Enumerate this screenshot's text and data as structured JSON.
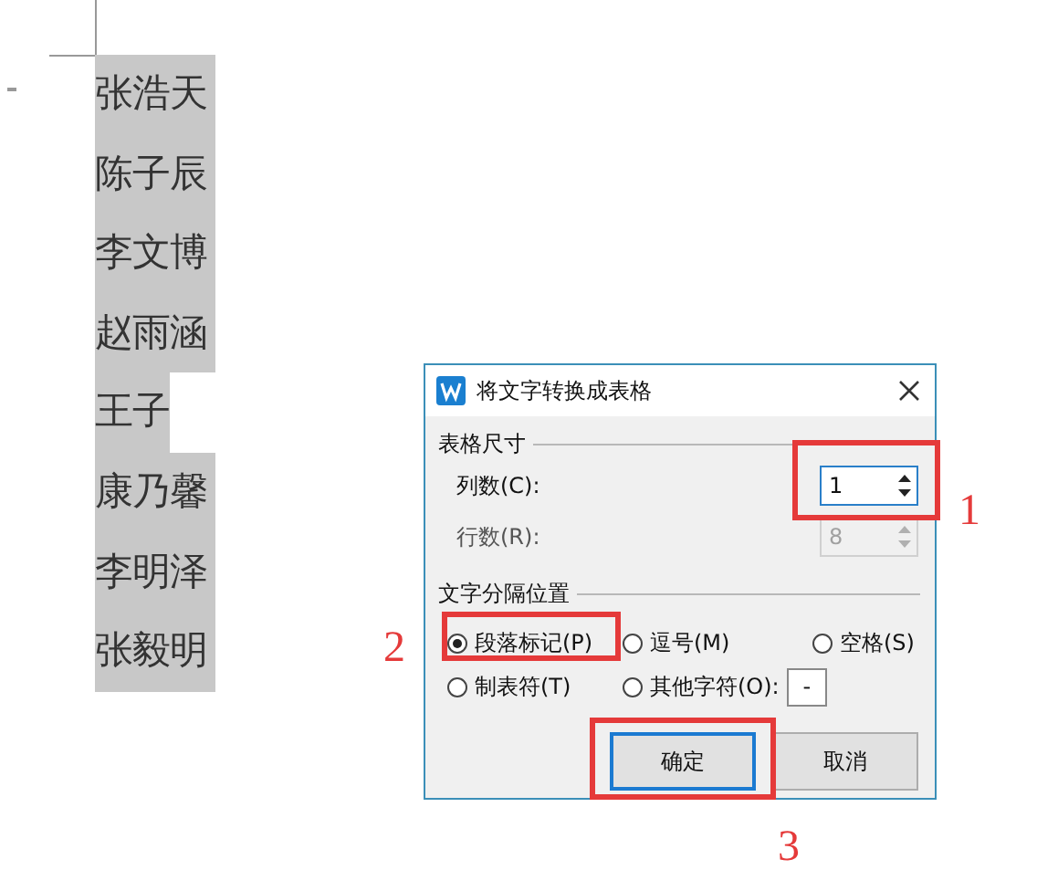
{
  "document": {
    "lines": [
      {
        "text": "张浩天",
        "selected": true
      },
      {
        "text": "陈子辰",
        "selected": true
      },
      {
        "text": "李文博",
        "selected": true
      },
      {
        "text": "赵雨涵",
        "selected": true
      },
      {
        "text": "王子",
        "selected": true
      },
      {
        "text": "康乃馨",
        "selected": true
      },
      {
        "text": "李明泽",
        "selected": true
      },
      {
        "text": "张毅明",
        "selected": true
      }
    ]
  },
  "dialog": {
    "title": "将文字转换成表格",
    "size_group": {
      "label": "表格尺寸",
      "fields": [
        {
          "label": "列数(C):",
          "value": "1",
          "disabled": false
        },
        {
          "label": "行数(R):",
          "value": "8",
          "disabled": true
        }
      ]
    },
    "separator_group": {
      "label": "文字分隔位置",
      "options": [
        {
          "label": "段落标记(P)",
          "selected": true,
          "kind": "plain"
        },
        {
          "label": "逗号(M)",
          "selected": false,
          "kind": "plain"
        },
        {
          "label": "空格(S)",
          "selected": false,
          "kind": "plain"
        },
        {
          "label": "制表符(T)",
          "selected": false,
          "kind": "plain"
        },
        {
          "label": "其他字符(O):",
          "selected": false,
          "kind": "other",
          "value": "-"
        }
      ]
    },
    "buttons": [
      {
        "label": "确定",
        "default": true
      },
      {
        "label": "取消",
        "default": false
      }
    ]
  },
  "annotations": [
    {
      "label": "1"
    },
    {
      "label": "2"
    },
    {
      "label": "3"
    }
  ]
}
